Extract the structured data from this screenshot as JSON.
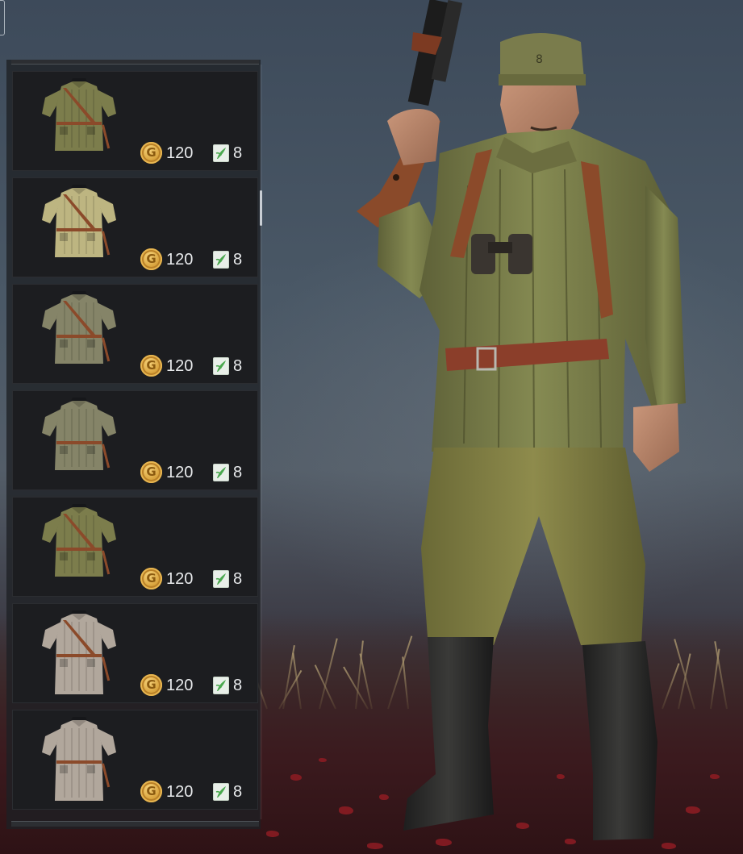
{
  "items": [
    {
      "outfit": "green-quilted-jacket",
      "gold_price": "120",
      "coin_glyph": "G",
      "ticket_price": "8"
    },
    {
      "outfit": "light-khaki-quilted-jacket",
      "gold_price": "120",
      "coin_glyph": "G",
      "ticket_price": "8"
    },
    {
      "outfit": "grey-green-quilted-jacket",
      "gold_price": "120",
      "coin_glyph": "G",
      "ticket_price": "8"
    },
    {
      "outfit": "grey-green-quilted-jacket-belt",
      "gold_price": "120",
      "coin_glyph": "G",
      "ticket_price": "8"
    },
    {
      "outfit": "green-quilted-jacket-harness",
      "gold_price": "120",
      "coin_glyph": "G",
      "ticket_price": "8"
    },
    {
      "outfit": "grey-long-greatcoat",
      "gold_price": "120",
      "coin_glyph": "G",
      "ticket_price": "8"
    },
    {
      "outfit": "grey-long-greatcoat-holster",
      "gold_price": "120",
      "coin_glyph": "G",
      "ticket_price": "8"
    }
  ],
  "colors": {
    "jacket_green": "#7c7d4c",
    "jacket_khaki": "#bdb581",
    "jacket_greygreen": "#858468",
    "greatcoat_grey": "#b1a79c",
    "leather": "#8b4a2a",
    "coin_gold": "#d9a43e",
    "ticket_green": "#4aa84e"
  },
  "preview": {
    "character": "soldier in quilted jacket with submachine gun, binoculars and leather belt"
  }
}
